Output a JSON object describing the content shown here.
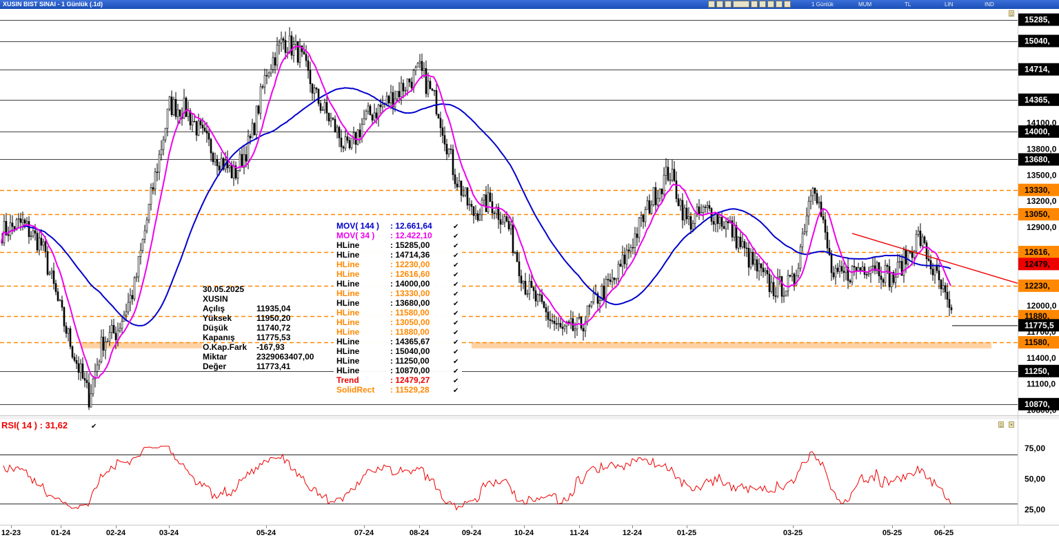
{
  "window": {
    "title": "XUSIN BIST SINAI - 1 Günlük (.1d)",
    "toolbar": {
      "period": "1 Günlük",
      "chart_style": "MUM",
      "currency": "TL",
      "scale": "LIN",
      "ind": "IND"
    }
  },
  "colors": {
    "hline": "#000000",
    "hline_orange": "#ff8800",
    "mov144": "#0000cc",
    "mov34": "#ee00ee",
    "trend": "#ee0000",
    "rsi": "#ee0000",
    "solidrect": "#ffcc99",
    "candle": "#000000"
  },
  "info_box": {
    "date": "30.05.2025",
    "symbol": "XUSIN",
    "rows": [
      {
        "label": "Açılış",
        "value": "11935,04"
      },
      {
        "label": "Yüksek",
        "value": "11950,20"
      },
      {
        "label": "Düşük",
        "value": "11740,72"
      },
      {
        "label": "Kapanış",
        "value": "11775,53"
      },
      {
        "label": "O.Kap.Fark",
        "value": "-167,93"
      },
      {
        "label": "Miktar",
        "value": "2329063407,00"
      },
      {
        "label": "Değer",
        "value": "11773,41"
      }
    ]
  },
  "legend": [
    {
      "name": "MOV( 144 )",
      "value": "12.661,64",
      "color": "#0000cc"
    },
    {
      "name": "MOV( 34 )",
      "value": "12.422,10",
      "color": "#ee00ee"
    },
    {
      "name": "HLine",
      "value": "15285,00",
      "color": "#000000"
    },
    {
      "name": "HLine",
      "value": "14714,36",
      "color": "#000000"
    },
    {
      "name": "HLine",
      "value": "12230,00",
      "color": "#ff8800"
    },
    {
      "name": "HLine",
      "value": "12616,60",
      "color": "#ff8800"
    },
    {
      "name": "HLine",
      "value": "14000,00",
      "color": "#000000"
    },
    {
      "name": "HLine",
      "value": "13330,00",
      "color": "#ff8800"
    },
    {
      "name": "HLine",
      "value": "13680,00",
      "color": "#000000"
    },
    {
      "name": "HLine",
      "value": "11580,00",
      "color": "#ff8800"
    },
    {
      "name": "HLine",
      "value": "13050,00",
      "color": "#ff8800"
    },
    {
      "name": "HLine",
      "value": "11880,00",
      "color": "#ff8800"
    },
    {
      "name": "HLine",
      "value": "14365,67",
      "color": "#000000"
    },
    {
      "name": "HLine",
      "value": "15040,00",
      "color": "#000000"
    },
    {
      "name": "HLine",
      "value": "11250,00",
      "color": "#000000"
    },
    {
      "name": "HLine",
      "value": "10870,00",
      "color": "#000000"
    },
    {
      "name": "Trend",
      "value": "12479,27",
      "color": "#ee0000"
    },
    {
      "name": "SolidRect",
      "value": "11529,28",
      "color": "#ff8800"
    }
  ],
  "rsi_label": "RSI( 14 )   : 31,62",
  "chart_data": [
    {
      "type": "candlestick",
      "title": "XUSIN BIST SINAI - 1 Günlük (.1d)",
      "ylim": [
        10750,
        15400
      ],
      "y_axis_labels": [
        "14100,0",
        "13800,0",
        "13500,0",
        "13200,0",
        "12900,0",
        "12000,0",
        "11700,0",
        "11400,0",
        "11100,0",
        "10800,0"
      ],
      "y_axis_label_values": [
        14100,
        13800,
        13500,
        13200,
        12900,
        12000,
        11700,
        11400,
        11100,
        10800
      ],
      "price_tags": [
        {
          "label": "15285,",
          "value": 15285,
          "style": "dark"
        },
        {
          "label": "15040,",
          "value": 15040,
          "style": "dark"
        },
        {
          "label": "14714,",
          "value": 14714.36,
          "style": "dark"
        },
        {
          "label": "14365,",
          "value": 14365.67,
          "style": "dark"
        },
        {
          "label": "14000,",
          "value": 14000,
          "style": "dark"
        },
        {
          "label": "13680,",
          "value": 13680,
          "style": "dark"
        },
        {
          "label": "13330,",
          "value": 13330,
          "style": "orange"
        },
        {
          "label": "13050,",
          "value": 13050,
          "style": "orange"
        },
        {
          "label": "12616,",
          "value": 12616.6,
          "style": "orange"
        },
        {
          "label": "12479,",
          "value": 12479.27,
          "style": "red"
        },
        {
          "label": "12230,",
          "value": 12230,
          "style": "orange"
        },
        {
          "label": "11880,",
          "value": 11880,
          "style": "orange"
        },
        {
          "label": "11775,5",
          "value": 11775.53,
          "style": "dark"
        },
        {
          "label": "11580,",
          "value": 11580,
          "style": "orange"
        },
        {
          "label": "11250,",
          "value": 11250,
          "style": "dark"
        },
        {
          "label": "10870,",
          "value": 10870,
          "style": "dark"
        }
      ],
      "hlines": [
        {
          "value": 15285,
          "style": "solid",
          "color": "#000000"
        },
        {
          "value": 15040,
          "style": "solid",
          "color": "#000000"
        },
        {
          "value": 14714.36,
          "style": "solid",
          "color": "#000000"
        },
        {
          "value": 14365.67,
          "style": "solid",
          "color": "#000000"
        },
        {
          "value": 14000,
          "style": "solid",
          "color": "#000000"
        },
        {
          "value": 13680,
          "style": "solid",
          "color": "#000000"
        },
        {
          "value": 13330,
          "style": "dash",
          "color": "#ff8800"
        },
        {
          "value": 13050,
          "style": "dash",
          "color": "#ff8800"
        },
        {
          "value": 12616.6,
          "style": "dash",
          "color": "#ff8800"
        },
        {
          "value": 12230,
          "style": "dash",
          "color": "#ff8800"
        },
        {
          "value": 11880,
          "style": "dash",
          "color": "#ff8800"
        },
        {
          "value": 11580,
          "style": "dash",
          "color": "#ff8800"
        },
        {
          "value": 11250,
          "style": "solid",
          "color": "#000000"
        },
        {
          "value": 10870,
          "style": "solid",
          "color": "#000000"
        }
      ],
      "solid_rect": {
        "value": 11529.28,
        "top": 11580,
        "bottom": 11510
      },
      "trend": {
        "start": {
          "x": "04-25",
          "y": 12830
        },
        "end": {
          "x": "06-25",
          "y": 12479.27
        }
      },
      "x_labels": [
        "12-23",
        "01-24",
        "02-24",
        "03-24",
        "05-24",
        "07-24",
        "08-24",
        "09-24",
        "10-24",
        "11-24",
        "12-24",
        "01-25",
        "03-25",
        "05-25",
        "06-25"
      ],
      "close_path": [
        [
          "12-23",
          12850
        ],
        [
          "",
          12950
        ],
        [
          "",
          12700
        ],
        [
          "01-24",
          11900
        ],
        [
          "",
          11400
        ],
        [
          "",
          10950
        ],
        [
          "",
          11600
        ],
        [
          "02-24",
          11700
        ],
        [
          "",
          12200
        ],
        [
          "",
          13300
        ],
        [
          "03-24",
          14300
        ],
        [
          "",
          14250
        ],
        [
          "",
          13950
        ],
        [
          "",
          13700
        ],
        [
          "",
          13500
        ],
        [
          "",
          13900
        ],
        [
          "05-24",
          14700
        ],
        [
          "",
          15050
        ],
        [
          "",
          14900
        ],
        [
          "",
          14400
        ],
        [
          "",
          14100
        ],
        [
          "",
          13750
        ],
        [
          "07-24",
          14150
        ],
        [
          "",
          14300
        ],
        [
          "",
          14500
        ],
        [
          "08-24",
          14700
        ],
        [
          "",
          14300
        ],
        [
          "",
          13500
        ],
        [
          "09-24",
          13050
        ],
        [
          "",
          13200
        ],
        [
          "",
          12950
        ],
        [
          "10-24",
          12250
        ],
        [
          "",
          11950
        ],
        [
          "",
          11700
        ],
        [
          "11-24",
          11750
        ],
        [
          "",
          12100
        ],
        [
          "",
          12300
        ],
        [
          "12-24",
          12750
        ],
        [
          "",
          13200
        ],
        [
          "",
          13550
        ],
        [
          "01-25",
          12950
        ],
        [
          "",
          13100
        ],
        [
          "",
          12900
        ],
        [
          "",
          12500
        ],
        [
          "",
          12200
        ],
        [
          "03-25",
          12250
        ],
        [
          "",
          13500
        ],
        [
          "",
          12300
        ],
        [
          "",
          12400
        ],
        [
          "",
          12500
        ],
        [
          "05-25",
          12300
        ],
        [
          "",
          12800
        ],
        [
          "06-25",
          12100
        ],
        [
          "",
          11775.53
        ]
      ],
      "series": [
        {
          "name": "MOV( 144 )",
          "last": 12661.64
        },
        {
          "name": "MOV( 34 )",
          "last": 12422.1
        },
        {
          "name": "Trend",
          "last": 12479.27
        }
      ]
    },
    {
      "type": "line",
      "title": "RSI( 14 )",
      "ylim": [
        15,
        88
      ],
      "y_axis_labels": [
        "75,00",
        "50,00",
        "25,00"
      ],
      "y_axis_label_values": [
        75,
        50,
        25
      ],
      "hlines": [
        70,
        30
      ],
      "series": [
        {
          "name": "RSI( 14 )",
          "last": 31.62
        }
      ]
    }
  ]
}
